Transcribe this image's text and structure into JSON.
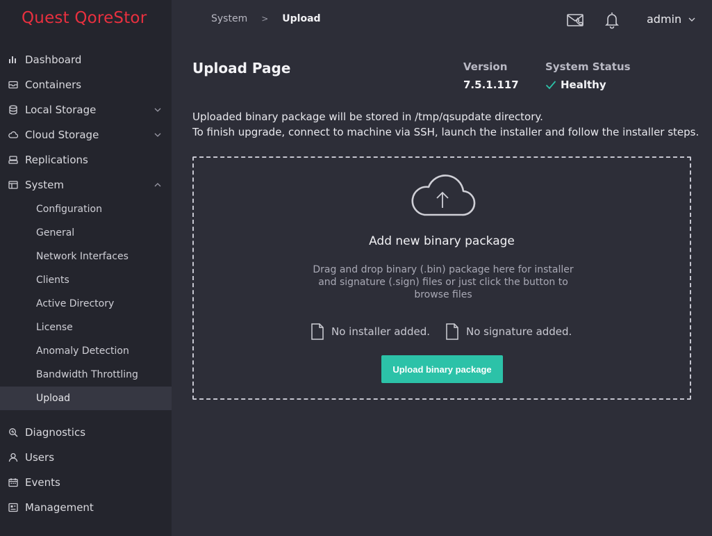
{
  "brand": {
    "logo_text": "Quest QoreStor",
    "accent": "#e8303f"
  },
  "sidebar": {
    "items": [
      {
        "label": "Dashboard",
        "icon": "bar-chart-icon"
      },
      {
        "label": "Containers",
        "icon": "container-icon"
      },
      {
        "label": "Local Storage",
        "icon": "database-icon",
        "expandable": true
      },
      {
        "label": "Cloud Storage",
        "icon": "cloud-icon",
        "expandable": true
      },
      {
        "label": "Replications",
        "icon": "replication-icon"
      },
      {
        "label": "System",
        "icon": "system-icon",
        "expanded": true
      }
    ],
    "system_children": [
      {
        "label": "Configuration"
      },
      {
        "label": "General"
      },
      {
        "label": "Network Interfaces"
      },
      {
        "label": "Clients"
      },
      {
        "label": "Active Directory"
      },
      {
        "label": "License"
      },
      {
        "label": "Anomaly Detection"
      },
      {
        "label": "Bandwidth Throttling"
      },
      {
        "label": "Upload",
        "active": true
      }
    ],
    "bottom_items": [
      {
        "label": "Diagnostics",
        "icon": "diagnostics-icon"
      },
      {
        "label": "Users",
        "icon": "user-icon"
      },
      {
        "label": "Events",
        "icon": "calendar-icon"
      },
      {
        "label": "Management",
        "icon": "management-icon"
      }
    ]
  },
  "header": {
    "breadcrumb": {
      "parent": "System",
      "separator": ">",
      "current": "Upload"
    },
    "user": "admin"
  },
  "main": {
    "title": "Upload Page",
    "version_label": "Version",
    "version_value": "7.5.1.117",
    "status_label": "System Status",
    "status_value": "Healthy",
    "status_color": "#2cc2a8",
    "info_line1": "Uploaded binary package will be stored in /tmp/qsupdate directory.",
    "info_line2": "To finish upgrade, connect to machine via SSH, launch the installer and follow the installer steps.",
    "dropzone": {
      "title": "Add new binary package",
      "description": "Drag and drop binary (.bin) package here for installer and signature (.sign) files or just click the button to browse files",
      "installer_status": "No installer added.",
      "signature_status": "No signature added.",
      "button_label": "Upload binary package"
    }
  }
}
